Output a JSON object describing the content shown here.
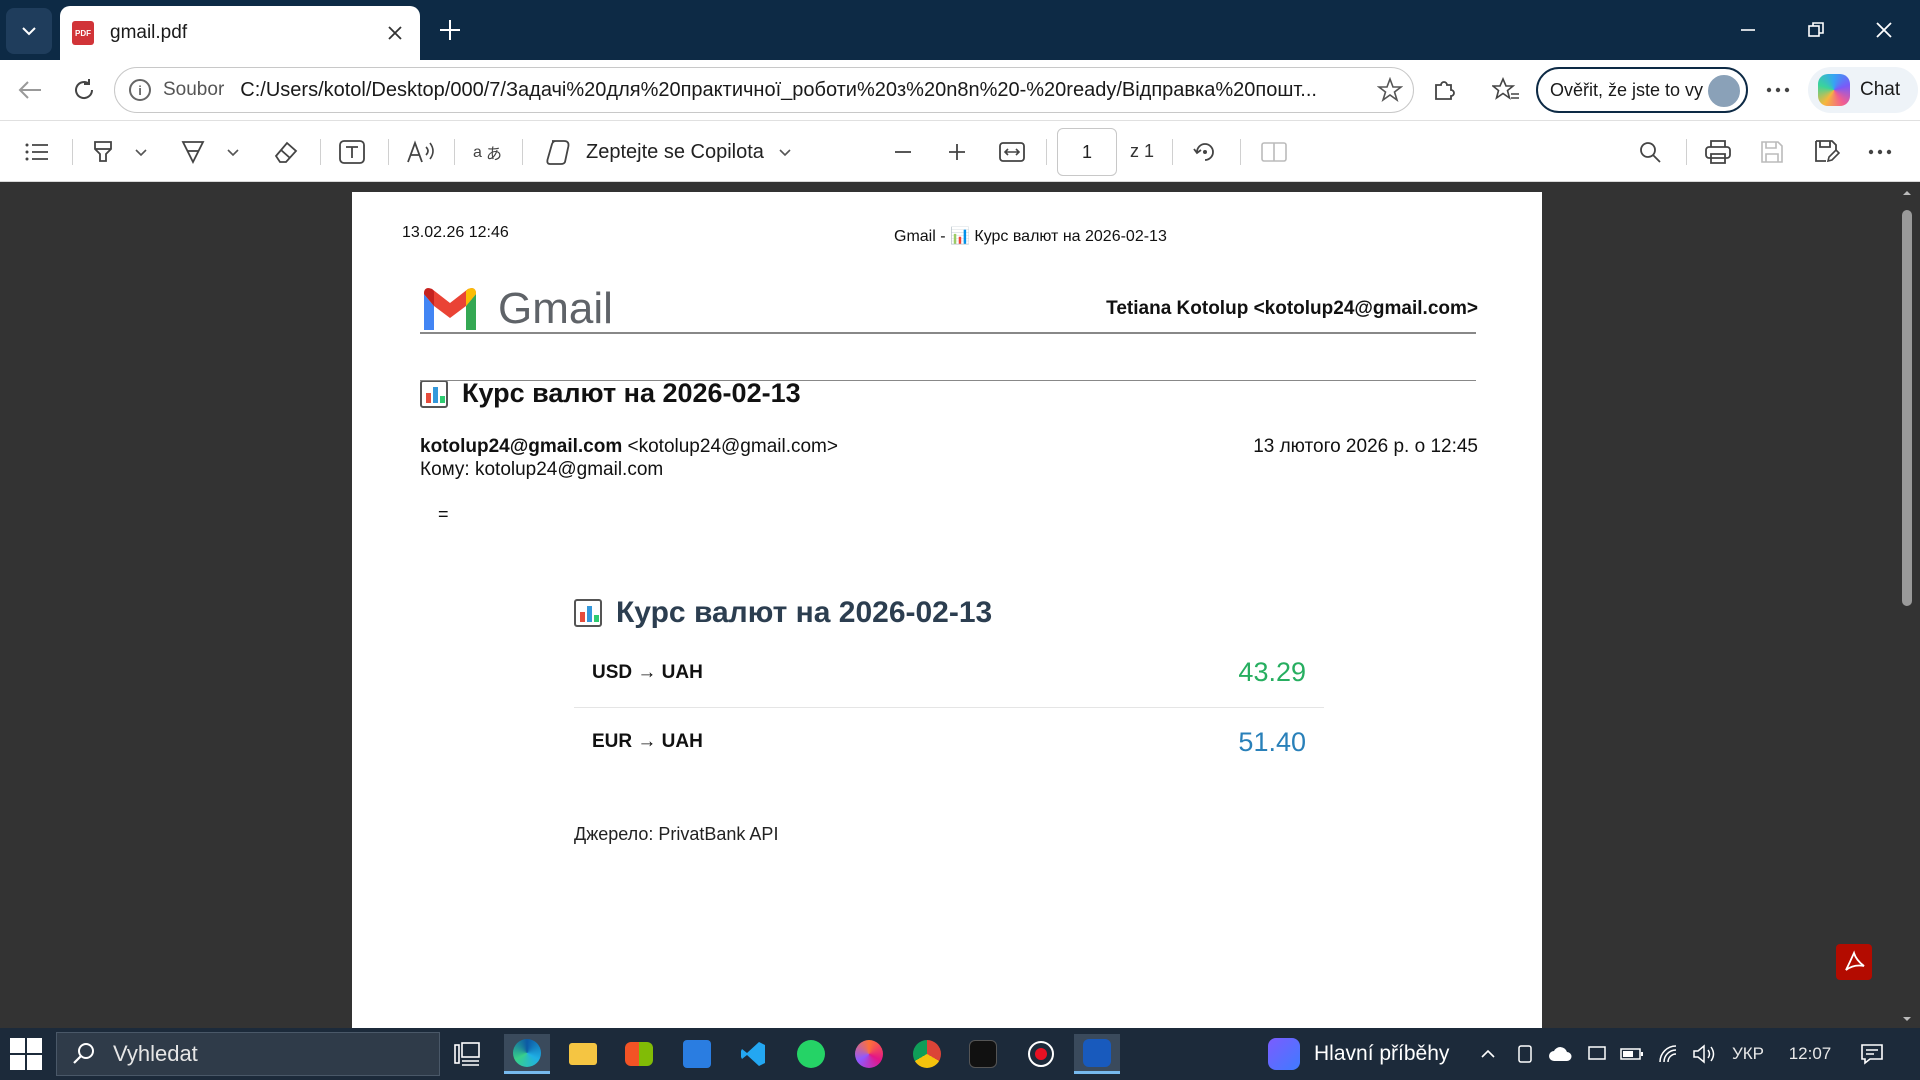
{
  "browser": {
    "tab_title": "gmail.pdf",
    "address_label": "Soubor",
    "address_url": "C:/Users/kotol/Desktop/000/7/Задачі%20для%20практичної_роботи%20з%20n8n%20-%20ready/Відправка%20пошт...",
    "verify_label": "Ověřit, že jste to vy",
    "chat_label": "Chat"
  },
  "pdf_toolbar": {
    "copilot_label": "Zeptejte se Copilota",
    "page_number": "1",
    "page_total": "z 1"
  },
  "pdf": {
    "print_date": "13.02.26 12:46",
    "print_title": "Gmail - 📊 Курс валют на 2026-02-13",
    "gmail_word": "Gmail",
    "account": "Tetiana Kotolup <kotolup24@gmail.com>",
    "subject": "Курс валют на 2026-02-13",
    "from_name": "kotolup24@gmail.com",
    "from_addr": "<kotolup24@gmail.com>",
    "sent_date": "13 лютого 2026 р. о 12:45",
    "to_line": "Кому: kotolup24@gmail.com",
    "eq": "=",
    "body_title": "Курс валют на 2026-02-13",
    "rates": [
      {
        "pair": "USD → UAH",
        "value": "43.29",
        "color": "#27ae60"
      },
      {
        "pair": "EUR → UAH",
        "value": "51.40",
        "color": "#2980b9"
      }
    ],
    "source": "Джерело: PrivatBank API"
  },
  "taskbar": {
    "search_label": "Vyhledat",
    "news_label": "Hlavní příběhy",
    "language": "УКР",
    "time": "12:07"
  }
}
